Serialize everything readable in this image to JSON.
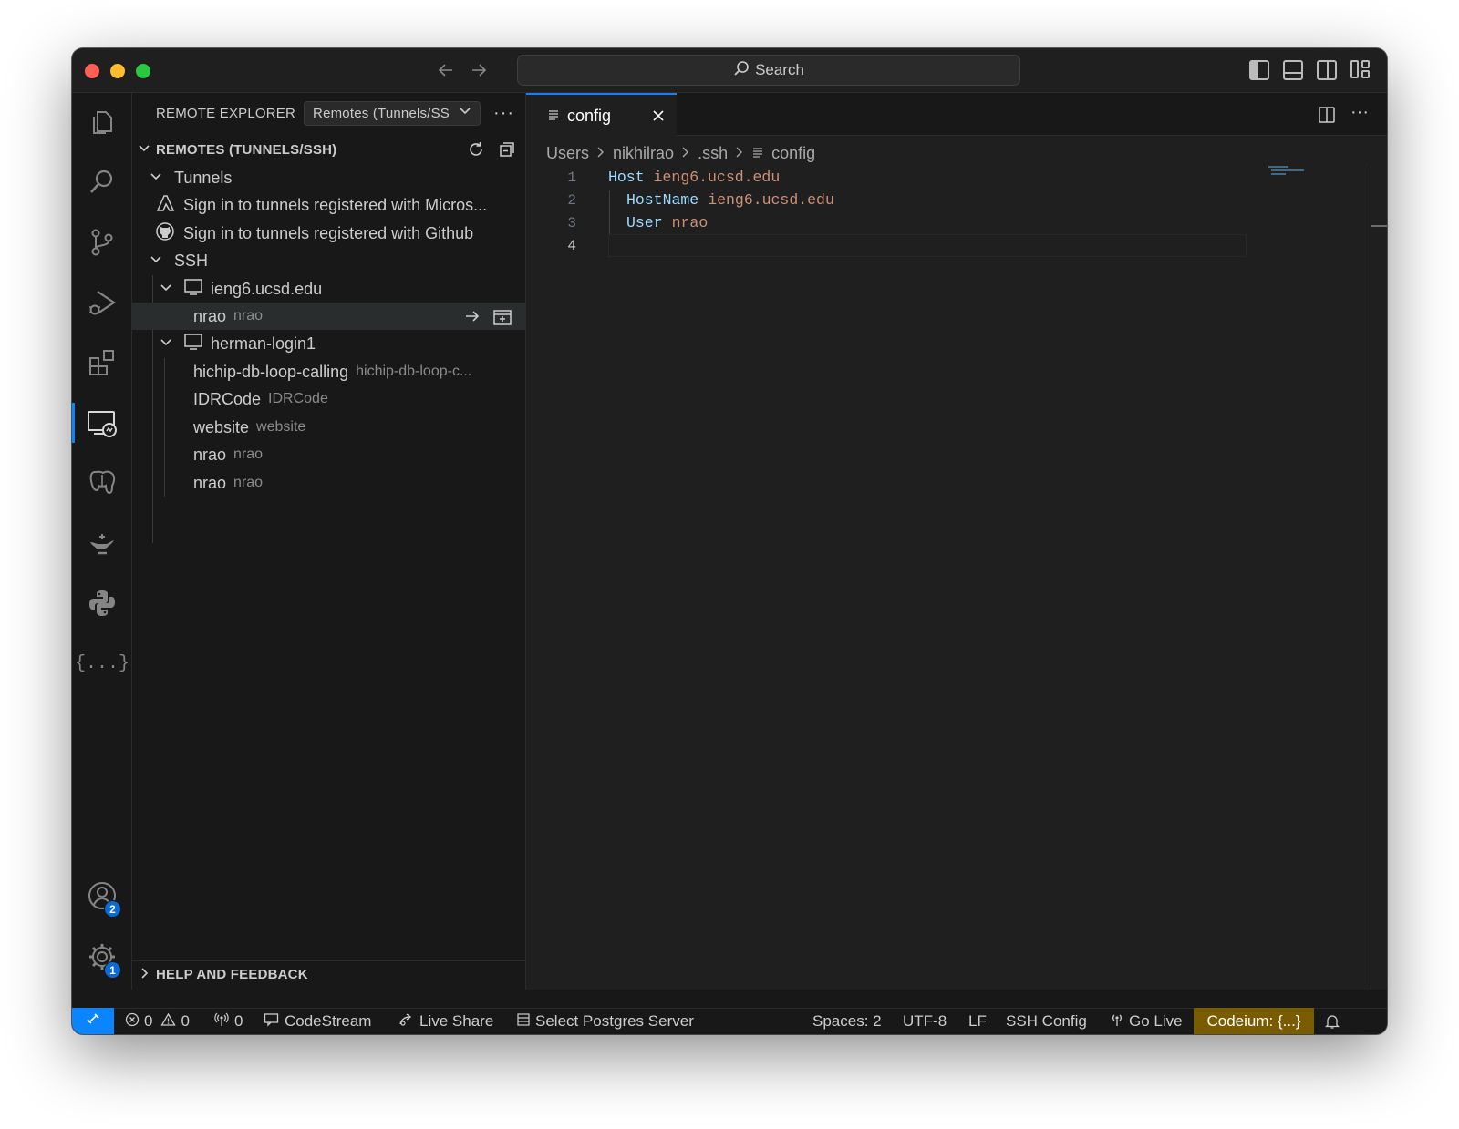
{
  "window": {
    "search_label": "Search"
  },
  "sidebar": {
    "header_title": "REMOTE EXPLORER",
    "dropdown_value": "Remotes (Tunnels/SS",
    "remotes_section": "REMOTES (TUNNELS/SSH)",
    "tunnels_group": "Tunnels",
    "tunnels_items": [
      "Sign in to tunnels registered with Micros...",
      "Sign in to tunnels registered with Github"
    ],
    "ssh_group": "SSH",
    "hosts": [
      {
        "name": "ieng6.ucsd.edu",
        "folders": [
          {
            "label": "nrao",
            "desc": "nrao"
          }
        ]
      },
      {
        "name": "herman-login1",
        "folders": [
          {
            "label": "hichip-db-loop-calling",
            "desc": "hichip-db-loop-c..."
          },
          {
            "label": "IDRCode",
            "desc": "IDRCode"
          },
          {
            "label": "website",
            "desc": "website"
          },
          {
            "label": "nrao",
            "desc": "nrao"
          },
          {
            "label": "nrao",
            "desc": "nrao"
          }
        ]
      }
    ],
    "help_section": "HELP AND FEEDBACK"
  },
  "activity_bar": {
    "accounts_badge": "2",
    "settings_badge": "1",
    "json_label": "{...}"
  },
  "editor": {
    "tab_label": "config",
    "breadcrumb": [
      "Users",
      "nikhilrao",
      ".ssh",
      "config"
    ],
    "lines": [
      {
        "num": "1",
        "key": "Host",
        "value": "ieng6.ucsd.edu"
      },
      {
        "num": "2",
        "key": "HostName",
        "value": "ieng6.ucsd.edu"
      },
      {
        "num": "3",
        "key": "User",
        "value": "nrao"
      },
      {
        "num": "4",
        "key": "",
        "value": ""
      }
    ]
  },
  "statusbar": {
    "errors": "0",
    "warnings": "0",
    "ports": "0",
    "codestream": "CodeStream",
    "live_share": "Live Share",
    "postgres": "Select Postgres Server",
    "spaces": "Spaces: 2",
    "encoding": "UTF-8",
    "eol": "LF",
    "language": "SSH Config",
    "go_live": "Go Live",
    "codeium": "Codeium: {...}",
    "codeium_bg": "#7a5c00"
  }
}
